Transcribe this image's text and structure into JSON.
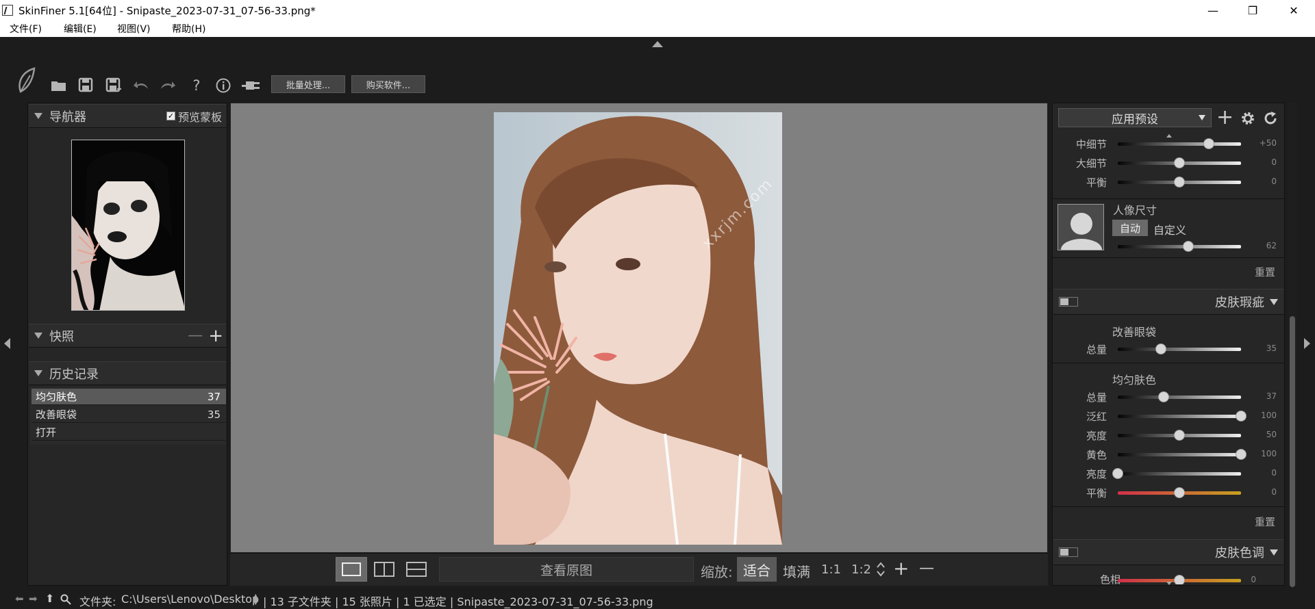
{
  "window": {
    "title": "SkinFiner 5.1[64位] - Snipaste_2023-07-31_07-56-33.png*"
  },
  "window_controls": {
    "minimize": "—",
    "maximize": "❐",
    "close": "✕"
  },
  "menu": [
    "文件(F)",
    "编辑(E)",
    "视图(V)",
    "帮助(H)"
  ],
  "toolbar": {
    "batch_label": "批量处理...",
    "buy_label": "购买软件...",
    "icons": [
      "logo-leaf-icon",
      "open-folder-icon",
      "save-icon",
      "save-as-icon",
      "undo-icon",
      "redo-icon",
      "help-icon",
      "info-icon",
      "plugin-icon"
    ]
  },
  "navigator": {
    "title": "导航器",
    "preview_mask_label": "预览蒙板",
    "preview_mask_checked": true
  },
  "snapshots": {
    "title": "快照",
    "remove": "—",
    "add": "+"
  },
  "history": {
    "title": "历史记录",
    "items": [
      {
        "label": "均匀肤色",
        "value": "37",
        "selected": true
      },
      {
        "label": "改善眼袋",
        "value": "35",
        "selected": false
      },
      {
        "label": "打开",
        "value": "",
        "selected": false
      }
    ]
  },
  "canvas": {
    "watermark": "xxrjm.com",
    "background": "#808080"
  },
  "bottom_bar": {
    "view_original": "查看原图",
    "zoom_label": "缩放:",
    "zoom_options": [
      "适合",
      "填满",
      "1:1",
      "1:2"
    ],
    "zoom_selected": "适合",
    "zoom_in": "+",
    "zoom_out": "—"
  },
  "right_panel": {
    "preset_label": "应用预设",
    "detail_sliders": [
      {
        "label": "中细节",
        "value": "+50",
        "level": 0.74,
        "track": "dark-light"
      },
      {
        "label": "大细节",
        "value": "0",
        "level": 0.5,
        "track": "dark-light"
      },
      {
        "label": "平衡",
        "value": "0",
        "level": 0.5,
        "track": "dark-light"
      }
    ],
    "portrait": {
      "title": "人像尺寸",
      "auto_label": "自动",
      "custom_label": "自定义",
      "value": "62",
      "level": 0.57
    },
    "reset1": "重置",
    "blemish": {
      "title": "皮肤瑕疵",
      "eyebag_title": "改善眼袋",
      "eyebag_sliders": [
        {
          "label": "总量",
          "value": "35",
          "level": 0.35,
          "track": "dark-light"
        }
      ],
      "tone_title": "均匀肤色",
      "tone_sliders": [
        {
          "label": "总量",
          "value": "37",
          "level": 0.37,
          "track": "dark-light"
        },
        {
          "label": "泛红",
          "value": "100",
          "level": 1.0,
          "track": "dark-light"
        },
        {
          "label": "亮度",
          "value": "50",
          "level": 0.5,
          "track": "dark-light"
        },
        {
          "label": "黄色",
          "value": "100",
          "level": 1.0,
          "track": "dark-light"
        },
        {
          "label": "亮度",
          "value": "0",
          "level": 0.0,
          "track": "dark-light"
        },
        {
          "label": "平衡",
          "value": "0",
          "level": 0.5,
          "track": "red-yellow"
        }
      ],
      "reset": "重置"
    },
    "tone_section": {
      "title": "皮肤色调",
      "partial_slider": {
        "label": "色相",
        "value": "0",
        "level": 0.5
      }
    }
  },
  "status": {
    "folder_label": "文件夹:",
    "path": "C:\\Users\\Lenovo\\Desktop",
    "info": "| 13 子文件夹 | 15 张照片 | 1 已选定 | Snipaste_2023-07-31_07-56-33.png"
  },
  "colors": {
    "bg": "#1c1c1c",
    "panel": "#262626",
    "canvas": "#808080",
    "knob": "#d7d7d7"
  }
}
